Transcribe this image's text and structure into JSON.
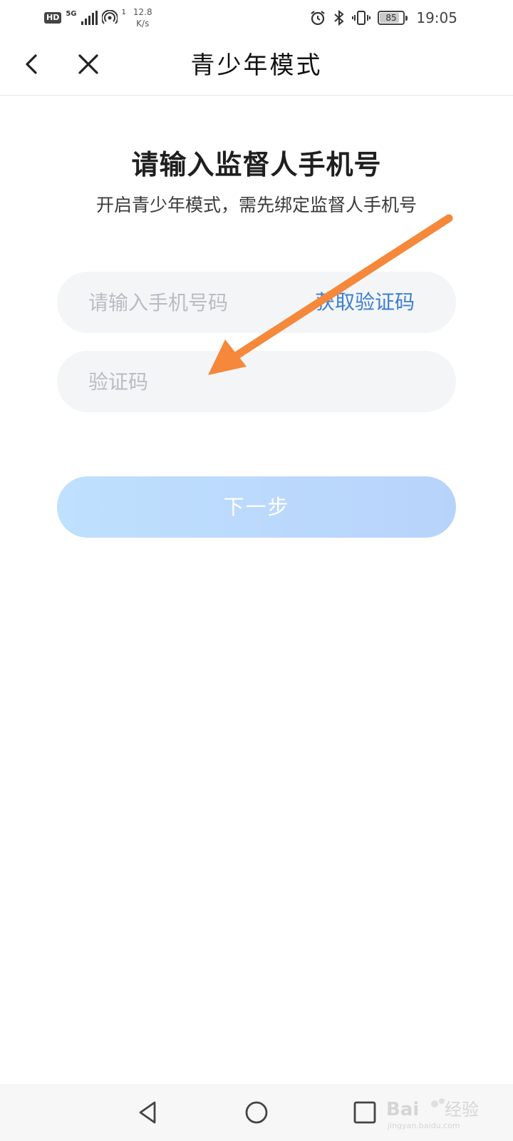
{
  "status_bar": {
    "hd": "HD",
    "network": "5G",
    "hotspot_count": "1",
    "speed_value": "12.8",
    "speed_unit": "K/s",
    "battery": "85",
    "battery_level": 0.85,
    "time": "19:05",
    "icons": [
      "signal-icon",
      "hotspot-icon",
      "alarm-icon",
      "bluetooth-icon",
      "vibrate-icon",
      "battery-icon"
    ]
  },
  "nav": {
    "title": "青少年模式",
    "back_icon": "chevron-left-icon",
    "close_icon": "close-icon"
  },
  "main": {
    "heading": "请输入监督人手机号",
    "subheading": "开启青少年模式，需先绑定监督人手机号",
    "phone_placeholder": "请输入手机号码",
    "get_code_label": "获取验证码",
    "code_placeholder": "验证码",
    "next_label": "下一步"
  },
  "colors": {
    "link": "#3b7fd2",
    "button_gradient_start": "#bfe0fe",
    "button_gradient_end": "#b8d3fb",
    "field_bg": "#f4f5f7",
    "annotation_arrow": "#f5883a"
  },
  "bottom_nav": {
    "icons": [
      "triangle-back-icon",
      "circle-home-icon",
      "square-recent-icon"
    ],
    "watermark_text": "Bai 经验",
    "watermark_sub": "jingyan.baidu.com"
  }
}
